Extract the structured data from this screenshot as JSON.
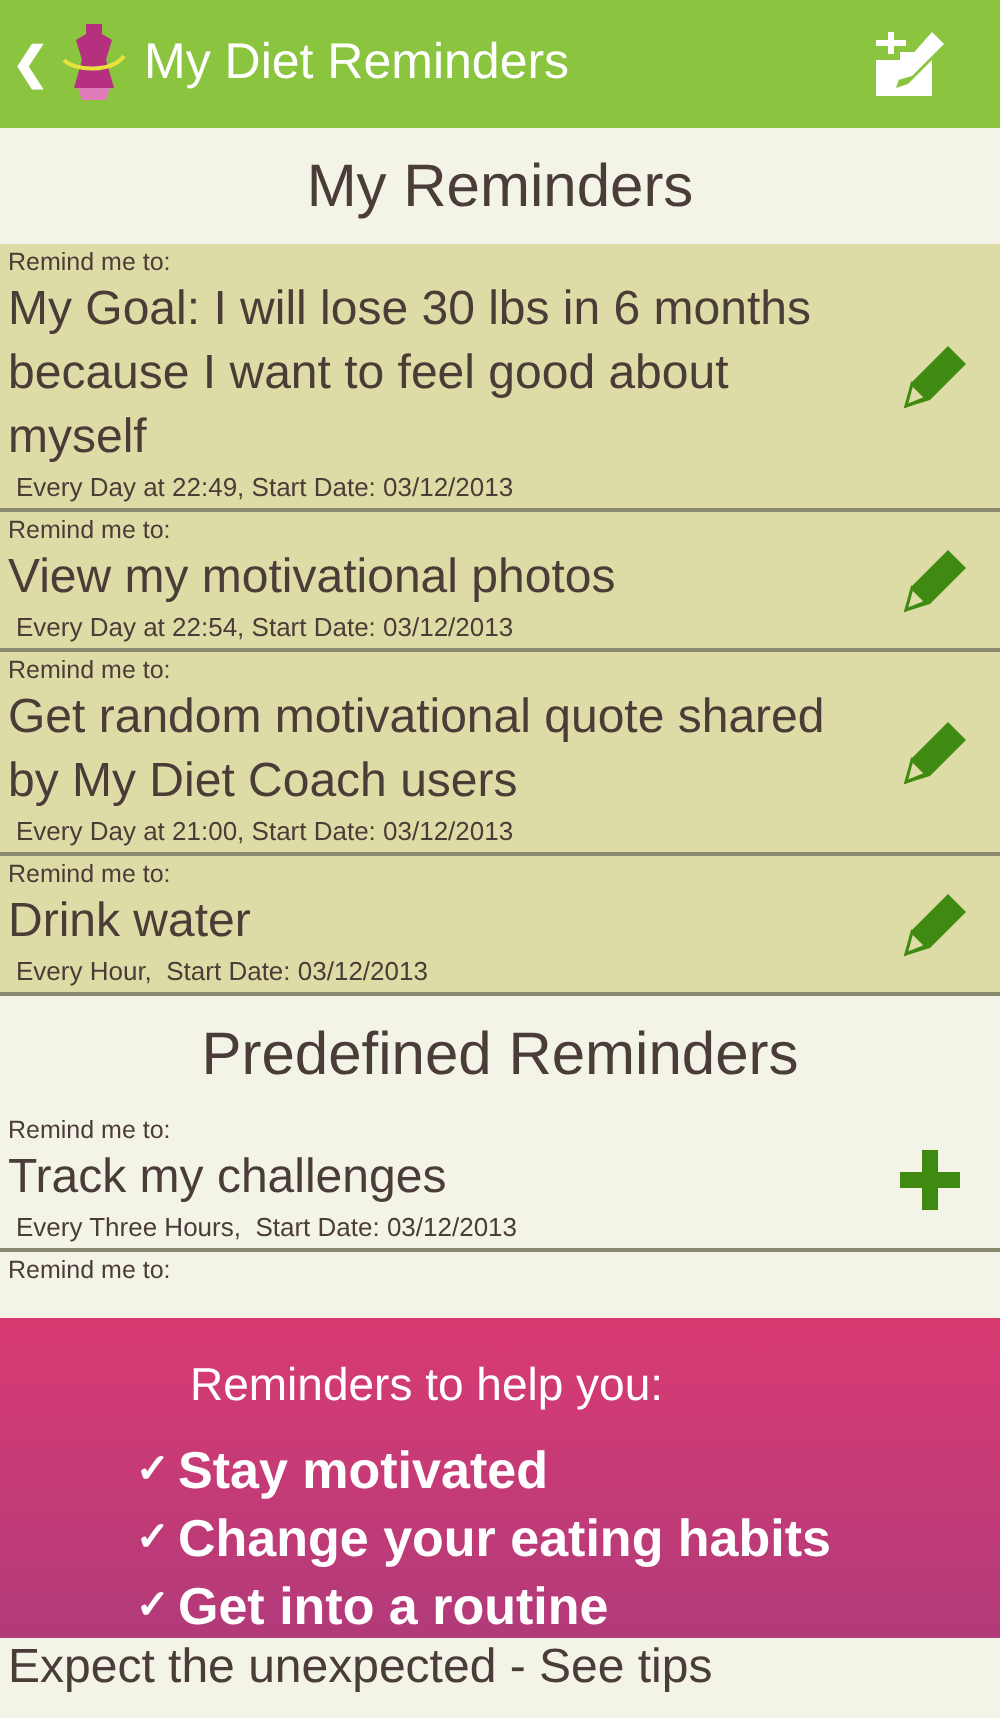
{
  "app_bar": {
    "title": "My Diet Reminders",
    "back": "❮"
  },
  "sections": [
    {
      "title": "My Reminders",
      "kind": "edit",
      "items": [
        {
          "label": "Remind me to:",
          "title": "My Goal: I will lose 30 lbs in 6 months because I want to feel good about myself",
          "detail": "Every Day at 22:49, Start Date: 03/12/2013"
        },
        {
          "label": "Remind me to:",
          "title": "View my motivational photos",
          "detail": "Every Day at 22:54, Start Date: 03/12/2013"
        },
        {
          "label": "Remind me to:",
          "title": "Get random motivational quote shared by My Diet Coach users",
          "detail": "Every Day at 21:00, Start Date: 03/12/2013"
        },
        {
          "label": "Remind me to:",
          "title": "Drink water",
          "detail": "Every Hour,  Start Date: 03/12/2013"
        }
      ]
    },
    {
      "title": "Predefined Reminders",
      "kind": "add",
      "items": [
        {
          "label": "Remind me to:",
          "title": "Track my challenges",
          "detail": "Every Three Hours,  Start Date: 03/12/2013"
        },
        {
          "label": "Remind me to:"
        }
      ]
    }
  ],
  "after_banner": {
    "title": "Expect the unexpected - See tips"
  },
  "banner": {
    "heading": "Reminders to help you:",
    "points": [
      "Stay motivated",
      "Change your eating habits",
      "Get into a routine"
    ],
    "check": "✓"
  }
}
